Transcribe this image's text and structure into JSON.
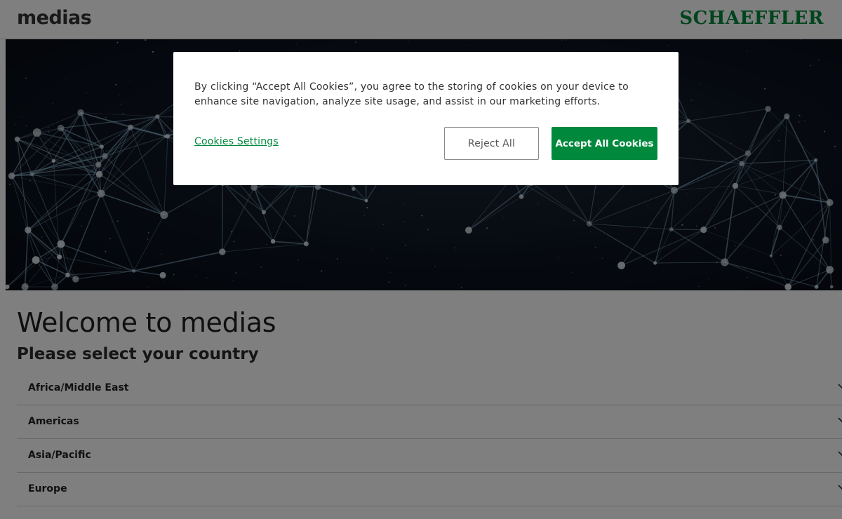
{
  "header": {
    "app_name": "medias",
    "brand": "SCHAEFFLER"
  },
  "main": {
    "title": "Welcome to medias",
    "subtitle": "Please select your country",
    "regions": [
      {
        "label": "Africa/Middle East",
        "icon": "chevron-down-icon"
      },
      {
        "label": "Americas",
        "icon": "chevron-down-icon"
      },
      {
        "label": "Asia/Pacific",
        "icon": "chevron-down-icon"
      },
      {
        "label": "Europe",
        "icon": "chevron-down-icon"
      }
    ]
  },
  "cookie_banner": {
    "text": "By clicking “Accept All Cookies”, you agree to the storing of cookies on your device to enhance site navigation, analyze site usage, and assist in our marketing efforts.",
    "settings_label": "Cookies Settings",
    "reject_label": "Reject All",
    "accept_label": "Accept All Cookies"
  },
  "colors": {
    "brand_green": "#00893d",
    "overlay": "rgba(0,0,0,0.5)"
  }
}
